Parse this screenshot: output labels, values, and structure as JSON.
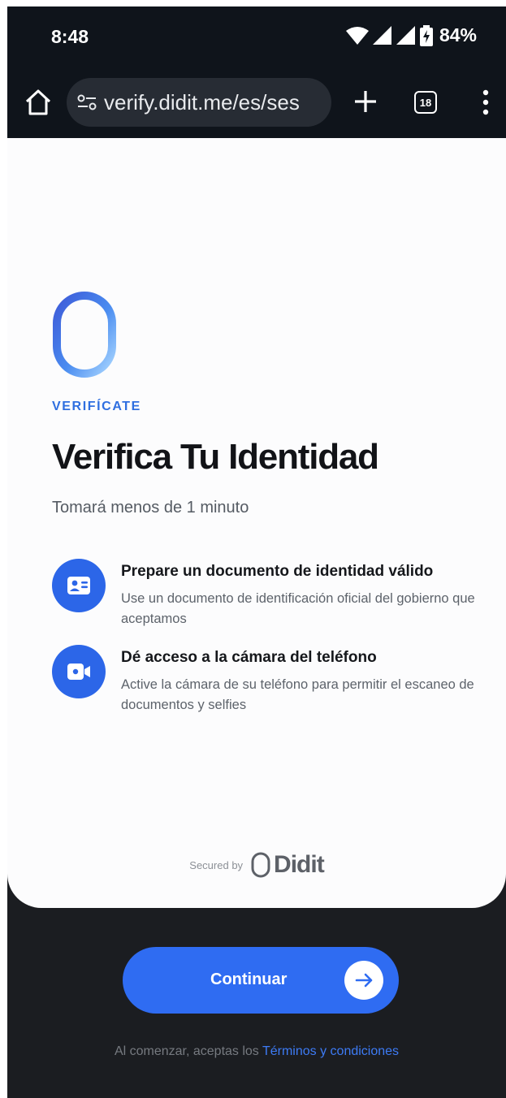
{
  "status_bar": {
    "time": "8:48",
    "battery_percent": "84%",
    "icons": [
      "wifi-icon",
      "signal-icon",
      "signal-icon",
      "battery-charging-icon"
    ]
  },
  "browser": {
    "url": "verify.didit.me/es/ses",
    "tab_count": "18",
    "icons": [
      "home-icon",
      "site-settings-icon",
      "plus-icon",
      "tabs-icon",
      "more-vert-icon"
    ]
  },
  "page": {
    "eyebrow": "VERIFÍCATE",
    "heading": "Verifica Tu Identidad",
    "subtext": "Tomará menos de 1 minuto",
    "features": [
      {
        "icon": "id-card-icon",
        "title": "Prepare un documento de identidad válido",
        "description": "Use un documento de identificación oficial del gobierno que aceptamos"
      },
      {
        "icon": "video-camera-icon",
        "title": "Dé acceso a la cámara del teléfono",
        "description": "Active la cámara de su teléfono para permitir el escaneo de documentos y selfies"
      }
    ],
    "secured_by": "Secured by",
    "brand": "Didit"
  },
  "footer": {
    "continue_label": "Continuar",
    "terms_prefix": "Al comenzar, aceptas los ",
    "terms_link": "Términos y condiciones"
  },
  "colors": {
    "accent": "#2f6cf2",
    "eyebrow": "#2f6fe0",
    "dark_background": "#1b1d21",
    "status_bar": "#0f141b"
  }
}
